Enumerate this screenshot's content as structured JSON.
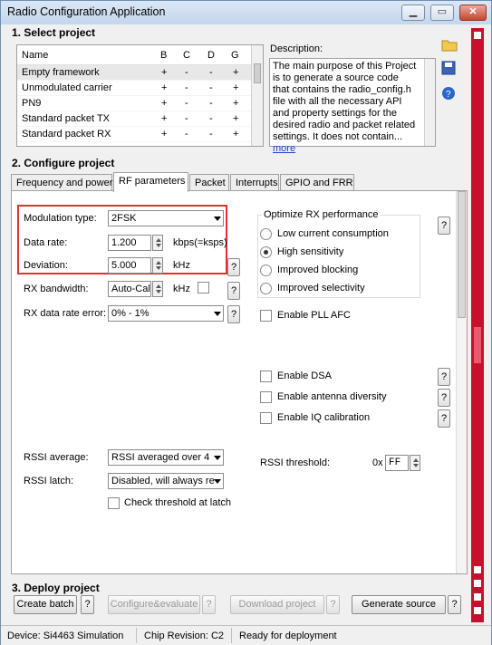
{
  "window": {
    "title": "Radio Configuration Application",
    "min": "▁",
    "max": "▭",
    "close": "✕"
  },
  "select_project": {
    "heading": "1. Select project",
    "columns": [
      "Name",
      "B",
      "C",
      "D",
      "G"
    ],
    "rows": [
      {
        "name": "Empty framework",
        "b": "+",
        "c": "-",
        "d": "-",
        "g": "+"
      },
      {
        "name": "Unmodulated carrier",
        "b": "+",
        "c": "-",
        "d": "-",
        "g": "+"
      },
      {
        "name": "PN9",
        "b": "+",
        "c": "-",
        "d": "-",
        "g": "+"
      },
      {
        "name": "Standard packet TX",
        "b": "+",
        "c": "-",
        "d": "-",
        "g": "+"
      },
      {
        "name": "Standard packet RX",
        "b": "+",
        "c": "-",
        "d": "-",
        "g": "+"
      }
    ],
    "description_label": "Description:",
    "description_text": "The main purpose of this Project is to generate a source code that contains the radio_config.h file with all the necessary API and property settings for the desired radio and packet related settings. It does not contain...",
    "more_link": "more"
  },
  "configure_project": {
    "heading": "2. Configure project",
    "tabs": [
      "Frequency and power",
      "RF parameters",
      "Packet",
      "Interrupts",
      "GPIO and FRR"
    ],
    "modulation_label": "Modulation type:",
    "modulation_value": "2FSK",
    "data_rate_label": "Data rate:",
    "data_rate_value": "1.200",
    "data_rate_unit": "kbps(=ksps)",
    "deviation_label": "Deviation:",
    "deviation_value": "5.000",
    "deviation_unit": "kHz",
    "rx_bw_label": "RX bandwidth:",
    "rx_bw_value": "Auto-Calc",
    "rx_bw_unit": "kHz",
    "rx_err_label": "RX data rate error:",
    "rx_err_value": "0% - 1%",
    "optimize_label": "Optimize RX performance",
    "optimize_options": [
      "Low current consumption",
      "High sensitivity",
      "Improved blocking",
      "Improved selectivity"
    ],
    "pll_afc": "Enable PLL AFC",
    "dsa": "Enable DSA",
    "antenna": "Enable antenna diversity",
    "iq": "Enable IQ calibration",
    "rssi_avg_label": "RSSI average:",
    "rssi_avg_value": "RSSI averaged over 4",
    "rssi_latch_label": "RSSI latch:",
    "rssi_latch_value": "Disabled, will always re",
    "check_threshold": "Check threshold at latch",
    "rssi_threshold_label": "RSSI threshold:",
    "rssi_threshold_prefix": "0x",
    "rssi_threshold_value": "FF",
    "help": "?"
  },
  "deploy_project": {
    "heading": "3. Deploy project",
    "create_batch": "Create batch",
    "configure_evaluate": "Configure&evaluate",
    "download_project": "Download project",
    "generate_source": "Generate source"
  },
  "status": {
    "device": "Device: Si4463  Simulation",
    "chip": "Chip Revision: C2",
    "state": "Ready for deployment"
  },
  "colors": {
    "highlight": "#e03030",
    "side_accent": "#c8102e",
    "link": "#1a44c8"
  }
}
